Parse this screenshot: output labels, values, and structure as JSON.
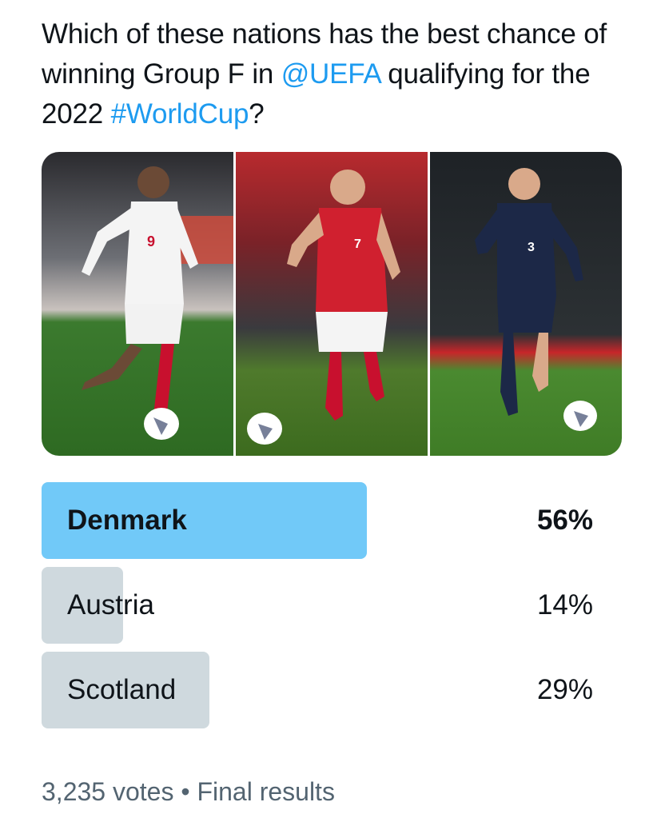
{
  "tweet": {
    "text_part1": "Which of these nations has the best chance of winning Group F in ",
    "mention": "@UEFA",
    "text_part2": " qualifying for the 2022 ",
    "hashtag": "#WorldCup",
    "text_part3": "?"
  },
  "media": {
    "panels": [
      {
        "subject": "Denmark player",
        "shirt_number": "9",
        "shirt_color": "#f4f4f4",
        "shorts_color": "#f2f2f2",
        "socks_color": "#c8102e"
      },
      {
        "subject": "Austria player",
        "shirt_number": "7",
        "shirt_color": "#d0202f",
        "shorts_color": "#f4f4f4",
        "socks_color": "#c8102e"
      },
      {
        "subject": "Scotland player",
        "shirt_number": "3",
        "shirt_color": "#1c2847",
        "shorts_color": "#1c2847",
        "socks_color": "#1c2847"
      }
    ]
  },
  "poll": {
    "options": [
      {
        "label": "Denmark",
        "percent": "56%",
        "fraction": 0.59,
        "winner": true
      },
      {
        "label": "Austria",
        "percent": "14%",
        "fraction": 0.148,
        "winner": false
      },
      {
        "label": "Scotland",
        "percent": "29%",
        "fraction": 0.305,
        "winner": false
      }
    ],
    "votes": "3,235 votes",
    "separator": "•",
    "status": "Final results"
  },
  "colors": {
    "link": "#1d9bf0",
    "winner_bar": "#71c9f8",
    "bar": "#cfd9de",
    "text": "#0f1419",
    "muted": "#536471"
  }
}
